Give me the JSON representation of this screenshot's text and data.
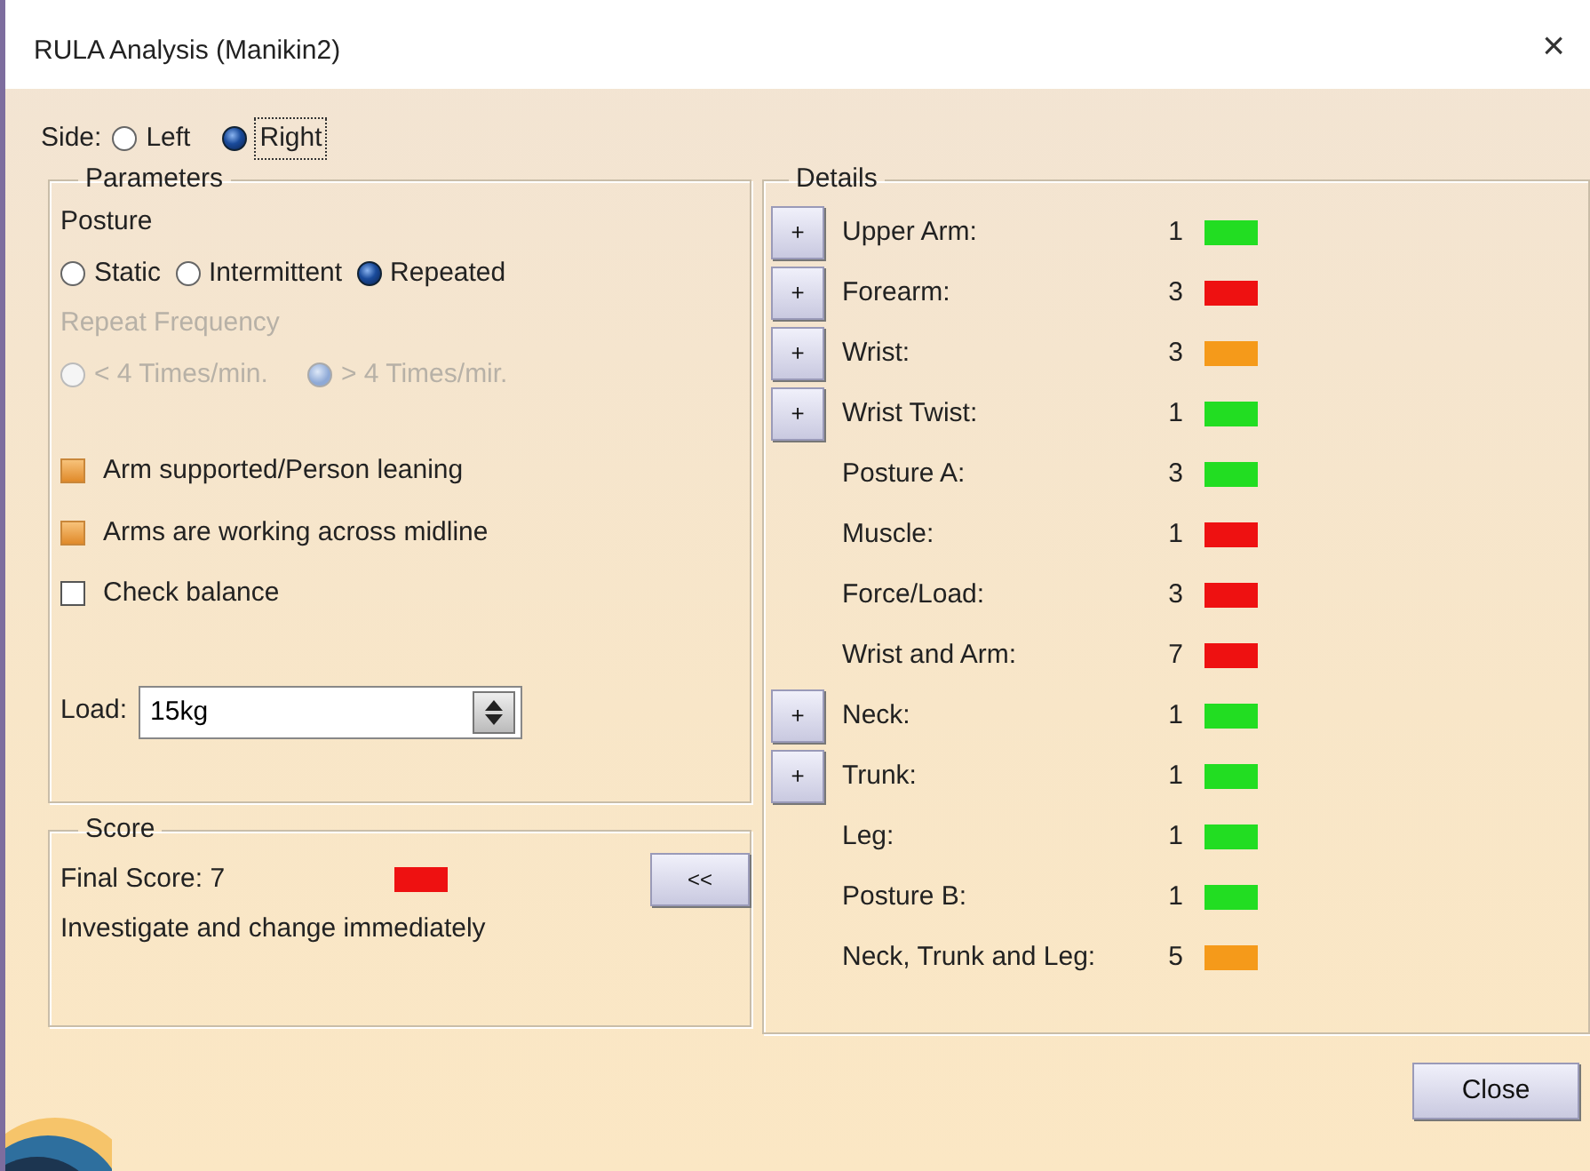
{
  "window": {
    "title": "RULA Analysis (Manikin2)",
    "close": "×"
  },
  "side": {
    "label": "Side:",
    "options": [
      {
        "label": "Left",
        "selected": false,
        "focused": false
      },
      {
        "label": "Right",
        "selected": true,
        "focused": true
      }
    ]
  },
  "parameters": {
    "title": "Parameters",
    "posture": {
      "label": "Posture",
      "options": [
        {
          "label": "Static",
          "selected": false
        },
        {
          "label": "Intermittent",
          "selected": false
        },
        {
          "label": "Repeated",
          "selected": true
        }
      ]
    },
    "repeat_frequency": {
      "label": "Repeat Frequency",
      "disabled": true,
      "options": [
        {
          "label": "< 4 Times/min.",
          "selected": false
        },
        {
          "label": "> 4 Times/mir.",
          "selected": true
        }
      ]
    },
    "checkboxes": [
      {
        "label": "Arm supported/Person leaning",
        "checked": true
      },
      {
        "label": "Arms are working across midline",
        "checked": true
      },
      {
        "label": "Check balance",
        "checked": false
      }
    ],
    "load": {
      "label": "Load:",
      "value": "15kg"
    }
  },
  "score": {
    "title": "Score",
    "final_score": "Final Score: 7",
    "color": "#ee1111",
    "message": "Investigate and change immediately",
    "collapse_button": "<<"
  },
  "details": {
    "title": "Details",
    "rows": [
      {
        "kind": "expandable",
        "expand": "+",
        "label": "Upper Arm:",
        "value": "1",
        "color": "#22dd22"
      },
      {
        "kind": "expandable",
        "expand": "+",
        "label": "Forearm:",
        "value": "3",
        "color": "#ee1111"
      },
      {
        "kind": "expandable",
        "expand": "+",
        "label": "Wrist:",
        "value": "3",
        "color": "#f59a1a"
      },
      {
        "kind": "expandable",
        "expand": "+",
        "label": "Wrist Twist:",
        "value": "1",
        "color": "#22dd22"
      },
      {
        "kind": "plain",
        "label": "Posture A:",
        "value": "3",
        "color": "#22dd22"
      },
      {
        "kind": "plain",
        "label": "Muscle:",
        "value": "1",
        "color": "#ee1111"
      },
      {
        "kind": "plain",
        "label": "Force/Load:",
        "value": "3",
        "color": "#ee1111"
      },
      {
        "kind": "plain",
        "label": "Wrist and Arm:",
        "value": "7",
        "color": "#ee1111"
      },
      {
        "kind": "expandable",
        "expand": "+",
        "label": "Neck:",
        "value": "1",
        "color": "#22dd22"
      },
      {
        "kind": "expandable",
        "expand": "+",
        "label": "Trunk:",
        "value": "1",
        "color": "#22dd22"
      },
      {
        "kind": "plain",
        "label": "Leg:",
        "value": "1",
        "color": "#22dd22"
      },
      {
        "kind": "plain",
        "label": "Posture B:",
        "value": "1",
        "color": "#22dd22"
      },
      {
        "kind": "plain",
        "label": "Neck, Trunk and Leg:",
        "value": "5",
        "color": "#f59a1a"
      }
    ]
  },
  "buttons": [
    {
      "label": "Close"
    }
  ]
}
